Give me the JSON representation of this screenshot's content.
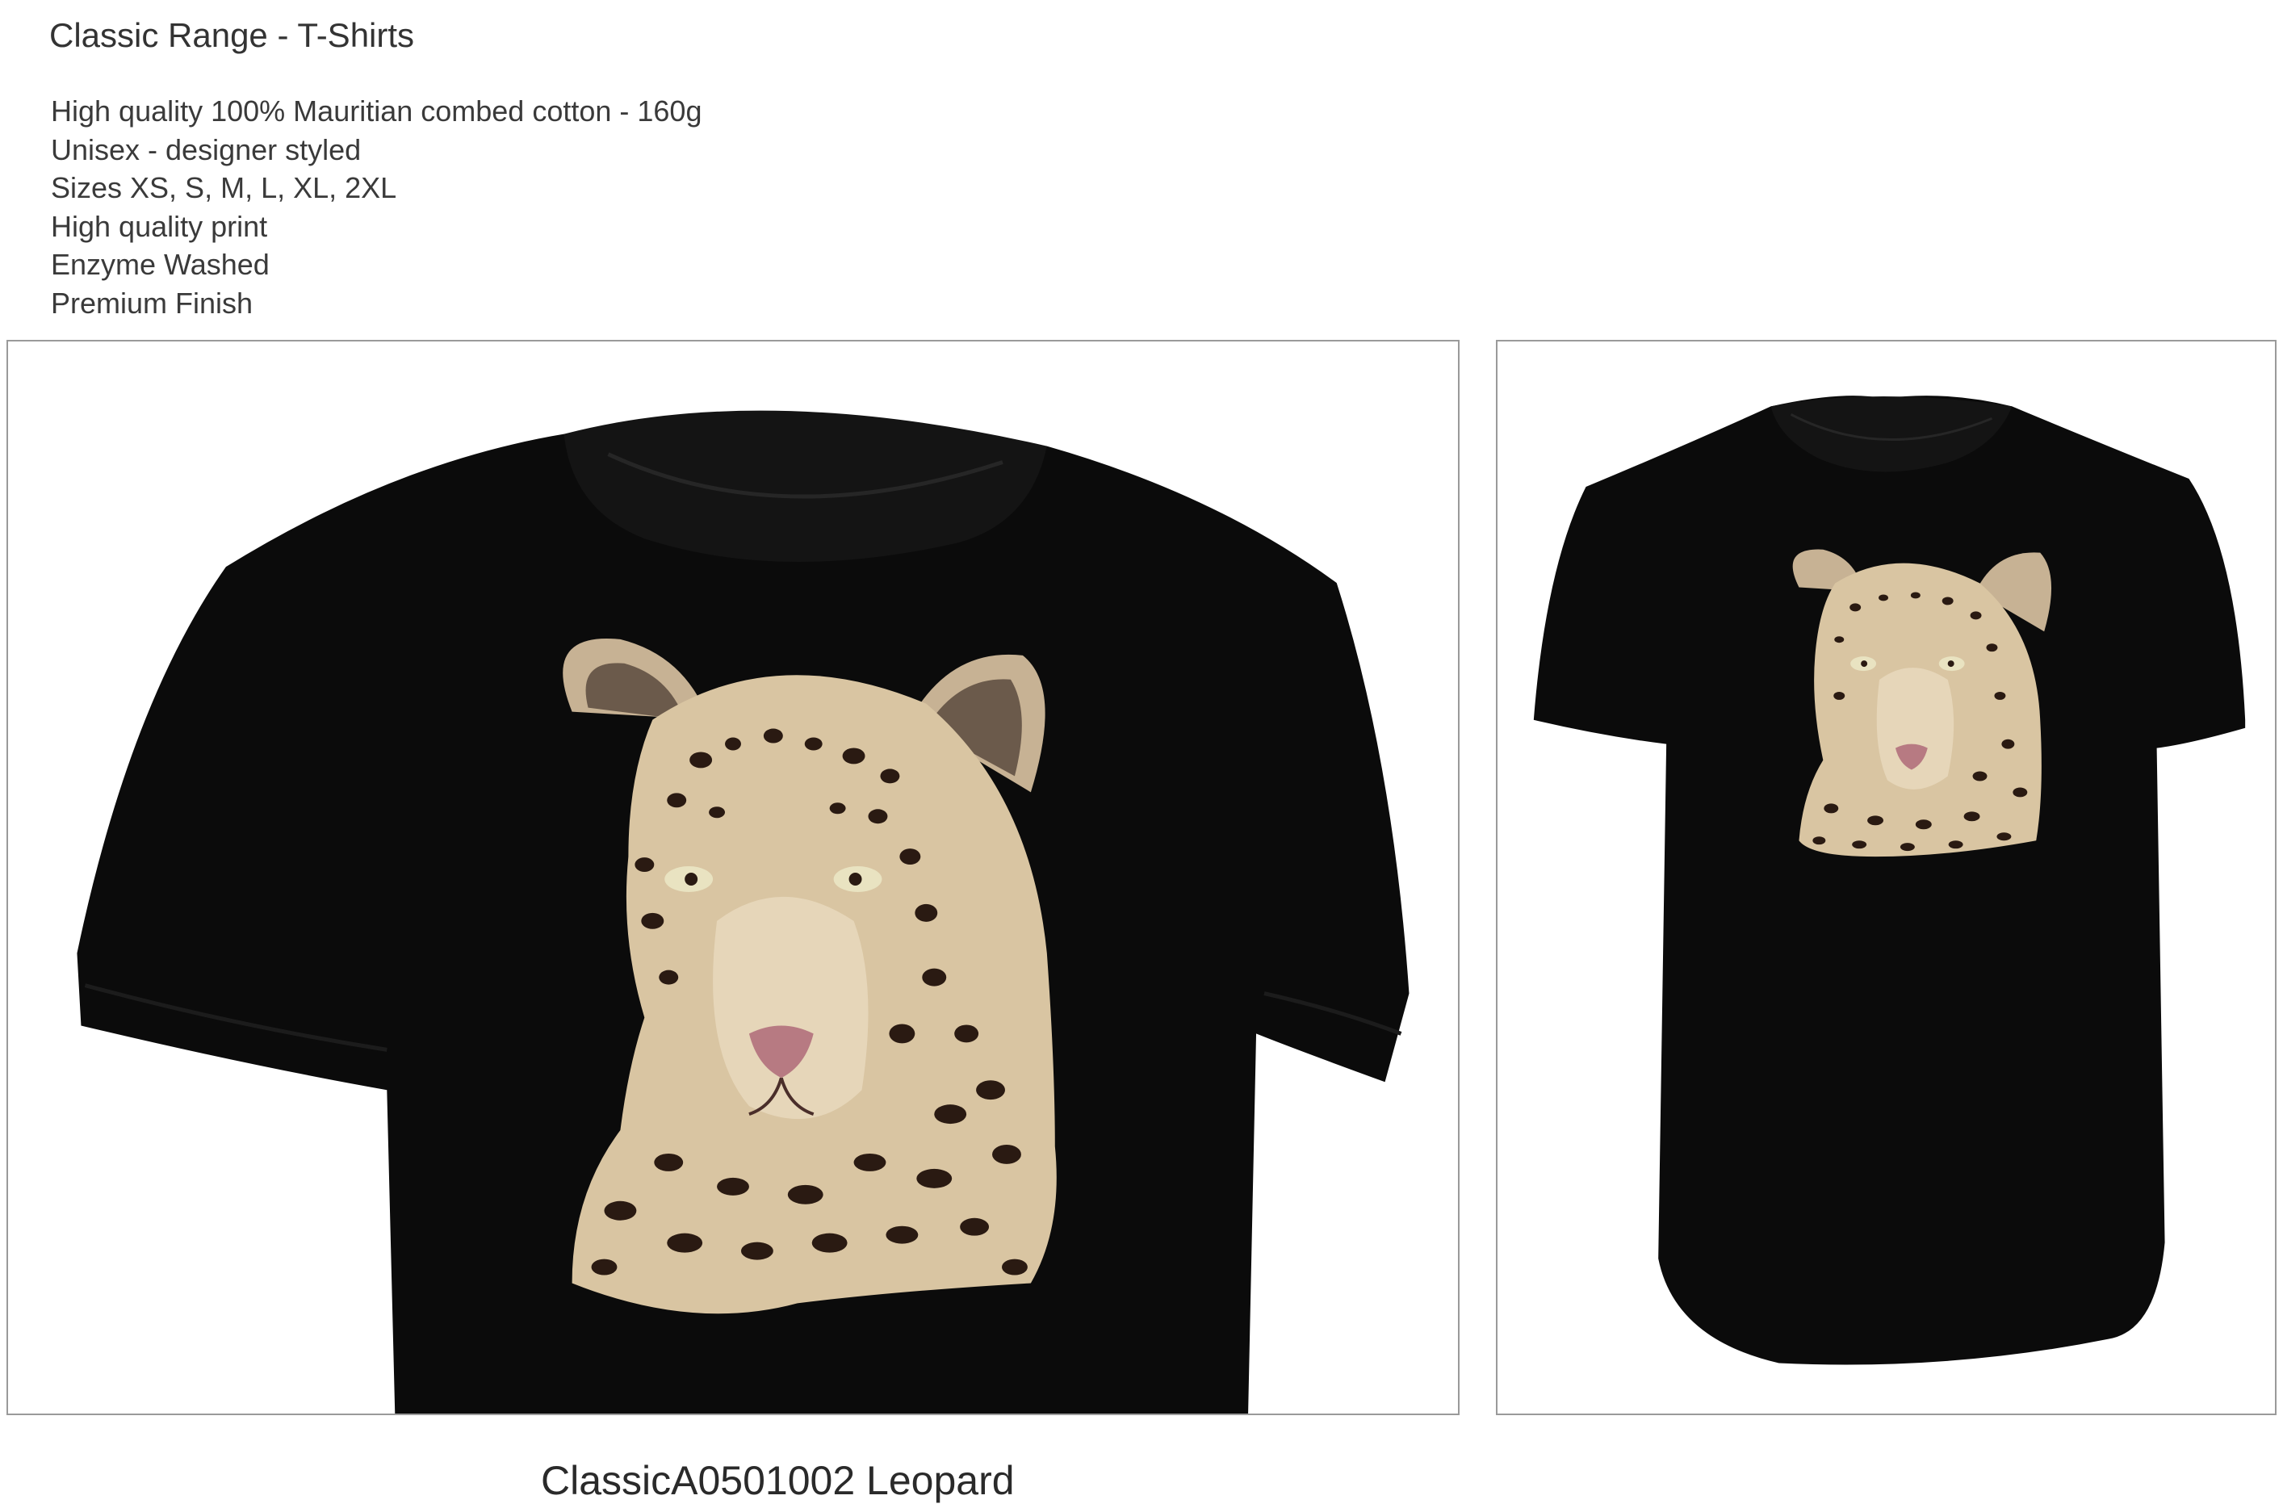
{
  "header": {
    "title": "Classic Range - T-Shirts"
  },
  "features": [
    "High quality 100% Mauritian combed cotton - 160g",
    "Unisex - designer styled",
    "Sizes XS, S, M, L, XL, 2XL",
    "High quality print",
    "Enzyme Washed",
    "Premium Finish"
  ],
  "product": {
    "caption": "ClassicA0501002 Leopard"
  },
  "colors": {
    "shirt": "#0b0b0b",
    "fur": "#d8c3a0",
    "spots": "#2a1a12",
    "nose": "#b77a82",
    "panel_border": "#9a9a9a"
  },
  "images": {
    "closeup_icon": "tshirt-closeup-image",
    "full_icon": "tshirt-full-image"
  }
}
